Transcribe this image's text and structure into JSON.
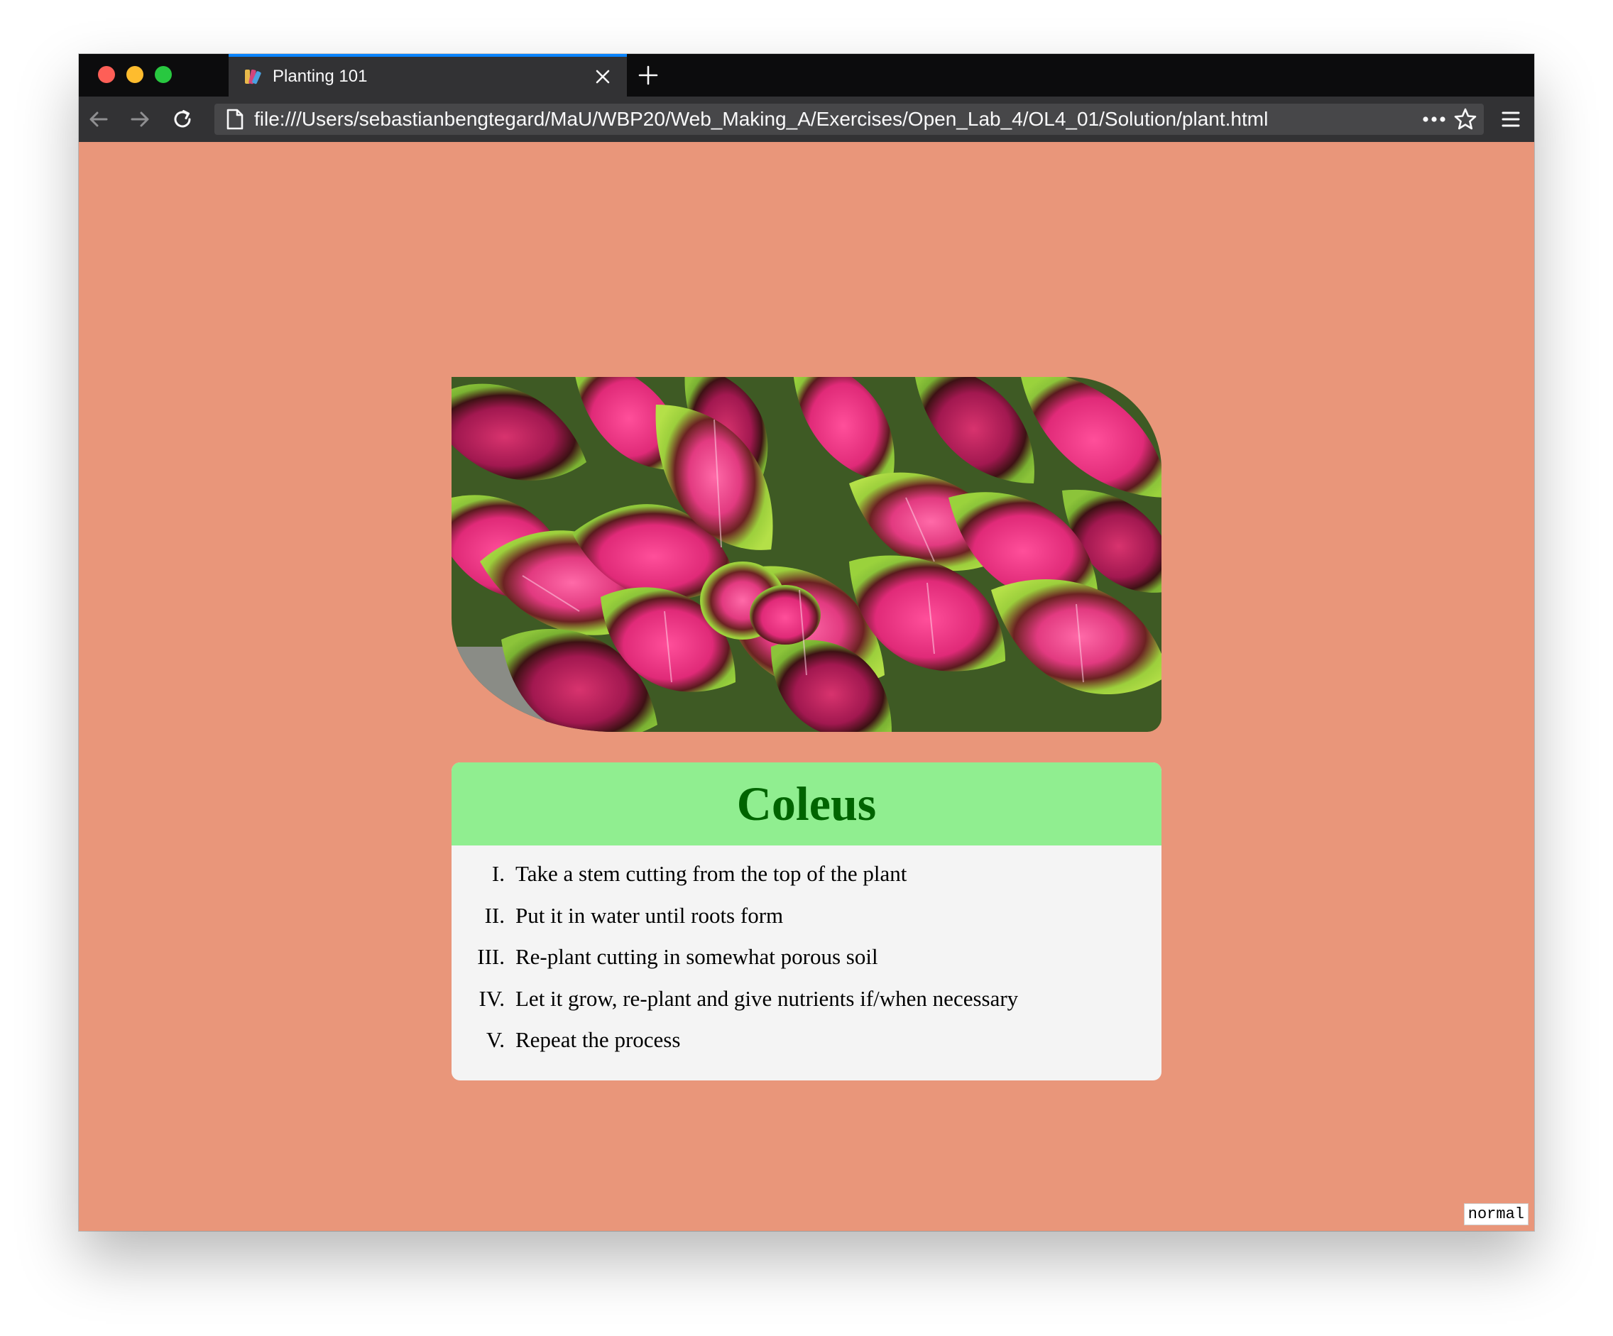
{
  "browser": {
    "tab_title": "Planting 101",
    "url": "file:///Users/sebastianbengtegard/MaU/WBP20/Web_Making_A/Exercises/Open_Lab_4/OL4_01/Solution/plant.html",
    "icons": {
      "back": "back-arrow-icon",
      "forward": "forward-arrow-icon",
      "reload": "reload-icon",
      "page": "page-icon",
      "more": "more-actions-icon",
      "bookmark": "bookmark-star-icon",
      "menu": "hamburger-menu-icon",
      "close_tab": "close-icon",
      "new_tab": "plus-icon"
    }
  },
  "page": {
    "background_color": "#e9967a",
    "image": {
      "subject": "coleus plant leaves"
    },
    "card": {
      "title": "Coleus",
      "title_color": "#006400",
      "header_color": "#90ee90",
      "steps": [
        {
          "number": "I.",
          "text": "Take a stem cutting from the top of the plant"
        },
        {
          "number": "II.",
          "text": "Put it in water until roots form"
        },
        {
          "number": "III.",
          "text": "Re-plant cutting in somewhat porous soil"
        },
        {
          "number": "IV.",
          "text": "Let it grow, re-plant and give nutrients if/when necessary"
        },
        {
          "number": "V.",
          "text": "Repeat the process"
        }
      ]
    },
    "mode_badge": "normal"
  }
}
